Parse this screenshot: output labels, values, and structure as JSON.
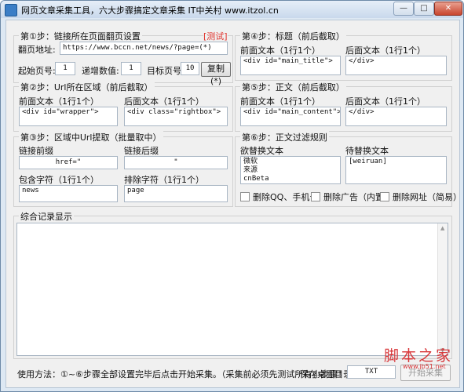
{
  "window": {
    "title": "网页文章采集工具，六大步骤搞定文章采集  IT中关村 www.itzol.cn",
    "min_label": "—",
    "max_label": "□",
    "close_label": "✕"
  },
  "step1": {
    "title": "第①步：链接所在页面翻页设置",
    "test_link": "[测试]",
    "page_url_label": "翻页地址:",
    "page_url_value": "https://www.bccn.net/news/?page=(*)",
    "start_label": "起始页号:",
    "start_value": "1",
    "step_label": "递增数值:",
    "step_value": "1",
    "target_label": "目标页号:",
    "target_value": "10",
    "copy_button": "复制(*)"
  },
  "step2": {
    "title": "第②步：Url所在区域（前后截取）",
    "front_label": "前面文本（1行1个）",
    "front_value": "<div id=\"wrapper\">",
    "back_label": "后面文本（1行1个）",
    "back_value": "<div class=\"rightbox\">"
  },
  "step3": {
    "title": "第③步：区域中Url提取（批量取中）",
    "prefix_label": "链接前缀",
    "prefix_value": "href=\"",
    "suffix_label": "链接后缀",
    "suffix_value": "\"",
    "include_label": "包含字符（1行1个）",
    "include_value": "news",
    "exclude_label": "排除字符（1行1个）",
    "exclude_value": "page"
  },
  "step4": {
    "title": "第④步：标题（前后截取）",
    "front_label": "前面文本（1行1个）",
    "front_value": "<div id=\"main_title\">",
    "back_label": "后面文本（1行1个）",
    "back_value": "</div>"
  },
  "step5": {
    "title": "第⑤步：正文（前后截取）",
    "front_label": "前面文本（1行1个）",
    "front_value": "<div id=\"main_content\">",
    "back_label": "后面文本（1行1个）",
    "back_value": "</div>"
  },
  "step6": {
    "title": "第⑥步：正文过滤规则",
    "replace_from_label": "欲替换文本",
    "replace_from_value": "微软\n来源\ncnBeta",
    "replace_to_label": "待替换文本",
    "replace_to_value": "[weiruan]",
    "options": [
      {
        "label": "删除QQ、手机号"
      },
      {
        "label": "删除广告（内置）"
      },
      {
        "label": "删除网址（简易）"
      }
    ]
  },
  "log": {
    "title": "综合记录显示"
  },
  "footer": {
    "usage": "使用方法：①~⑥步骤全部设置完毕后点击开始采集。（采集前必须先测试所有小步骤！）",
    "save_label": "保存桌面目录:",
    "save_value": "TXT",
    "start_button": "开始采集"
  },
  "watermark": {
    "text": "脚本之家",
    "url": "www.jb51.net"
  }
}
